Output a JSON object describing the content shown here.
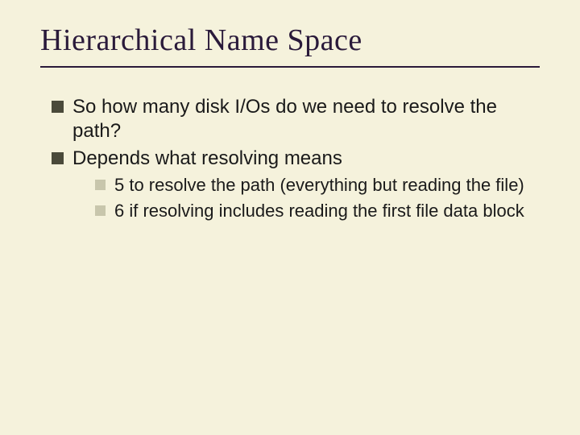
{
  "title": "Hierarchical Name Space",
  "bullets": [
    {
      "text": "So how many disk I/Os do we need to resolve the path?"
    },
    {
      "text": "Depends what resolving means",
      "children": [
        {
          "text": "5 to resolve the path (everything but reading the file)"
        },
        {
          "text": "6 if resolving includes reading the first file data block"
        }
      ]
    }
  ]
}
